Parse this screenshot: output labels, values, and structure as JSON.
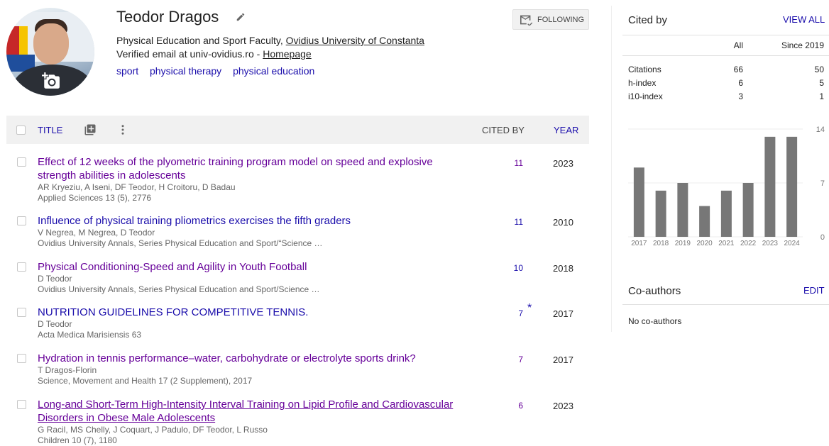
{
  "profile": {
    "name": "Teodor Dragos",
    "affiliation_prefix": "Physical Education and Sport Faculty, ",
    "affiliation_link": "Ovidius University of Constanta",
    "verified_prefix": "Verified email at univ-ovidius.ro - ",
    "homepage_link": "Homepage",
    "interests": [
      "sport",
      "physical therapy",
      "physical education"
    ],
    "follow_label": "FOLLOWING"
  },
  "table": {
    "title_header": "TITLE",
    "cited_header": "CITED BY",
    "year_header": "YEAR",
    "rows": [
      {
        "title": "Effect of 12 weeks of the plyometric training program model on speed and explosive strength abilities in adolescents",
        "authors": "AR Kryeziu, A Iseni, DF Teodor, H Croitoru, D Badau",
        "venue": "Applied Sciences 13 (5), 2776",
        "cited": "11",
        "year": "2023"
      },
      {
        "title": "Influence of physical training pliometrics exercises the fifth graders",
        "authors": "V Negrea, M Negrea, D Teodor",
        "venue": "Ovidius University Annals, Series Physical Education and Sport/“Science …",
        "cited": "11",
        "year": "2010"
      },
      {
        "title": "Physical Conditioning-Speed and Agility in Youth Football",
        "authors": "D Teodor",
        "venue": "Ovidius University Annals, Series Physical Education and Sport/Science …",
        "cited": "10",
        "year": "2018"
      },
      {
        "title": "NUTRITION GUIDELINES FOR COMPETITIVE TENNIS.",
        "authors": "D Teodor",
        "venue": "Acta Medica Marisiensis 63",
        "cited": "7",
        "star": "*",
        "year": "2017"
      },
      {
        "title": "Hydration in tennis performance–water, carbohydrate or electrolyte sports drink?",
        "authors": "T Dragos-Florin",
        "venue": "Science, Movement and Health 17 (2 Supplement), 2017",
        "cited": "7",
        "year": "2017"
      },
      {
        "title": "Long-and Short-Term High-Intensity Interval Training on Lipid Profile and Cardiovascular Disorders in Obese Male Adolescents",
        "authors": "G Racil, MS Chelly, J Coquart, J Padulo, DF Teodor, L Russo",
        "venue": "Children 10 (7), 1180",
        "cited": "6",
        "year": "2023"
      }
    ]
  },
  "cited_by": {
    "heading": "Cited by",
    "view_all": "VIEW ALL",
    "col_all": "All",
    "col_since": "Since 2019",
    "stats": [
      {
        "label": "Citations",
        "all": "66",
        "since": "50"
      },
      {
        "label": "h-index",
        "all": "6",
        "since": "5"
      },
      {
        "label": "i10-index",
        "all": "3",
        "since": "1"
      }
    ]
  },
  "chart_data": {
    "type": "bar",
    "categories": [
      "2017",
      "2018",
      "2019",
      "2020",
      "2021",
      "2022",
      "2023",
      "2024"
    ],
    "values": [
      9,
      6,
      7,
      4,
      6,
      7,
      13,
      13
    ],
    "yticks": [
      "0",
      "7",
      "14"
    ],
    "ylim": [
      0,
      14
    ],
    "bar_color": "#777777",
    "grid": true
  },
  "coauthors": {
    "heading": "Co-authors",
    "edit": "EDIT",
    "empty": "No co-authors"
  }
}
